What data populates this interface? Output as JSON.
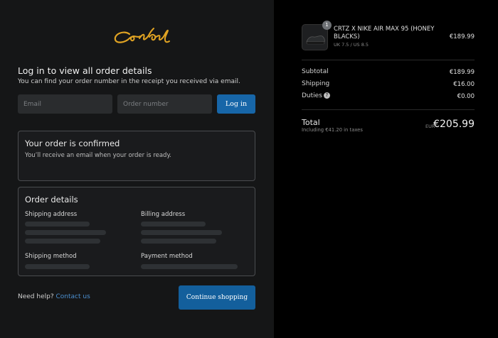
{
  "brand": {
    "logo_text": "Corteiz",
    "logo_color": "#e0a323"
  },
  "login": {
    "title": "Log in to view all order details",
    "subtitle": "You can find your order number in the receipt you received via email.",
    "email_placeholder": "Email",
    "order_number_placeholder": "Order number",
    "login_label": "Log in"
  },
  "confirmation": {
    "title": "Your order is confirmed",
    "text": "You’ll receive an email when your order is ready."
  },
  "order_details": {
    "title": "Order details",
    "shipping_address_label": "Shipping address",
    "billing_address_label": "Billing address",
    "shipping_method_label": "Shipping method",
    "payment_method_label": "Payment method"
  },
  "footer": {
    "help_text": "Need help?",
    "contact_label": "Contact us",
    "continue_label": "Continue shopping"
  },
  "cart": {
    "item": {
      "quantity": "1",
      "name": "CRTZ X NIKE AIR MAX 95 (HONEY BLACKS)",
      "variant": "UK 7.5 / US 8.5",
      "price": "€189.99"
    },
    "subtotal_label": "Subtotal",
    "subtotal": "€189.99",
    "shipping_label": "Shipping",
    "shipping": "€16.00",
    "duties_label": "Duties",
    "duties": "€0.00",
    "total_label": "Total",
    "tax_note": "Including €41.20 in taxes",
    "currency": "EUR",
    "total": "€205.99"
  },
  "colors": {
    "accent": "#1766a8",
    "background": "#151617",
    "summary_bg": "#000000"
  }
}
